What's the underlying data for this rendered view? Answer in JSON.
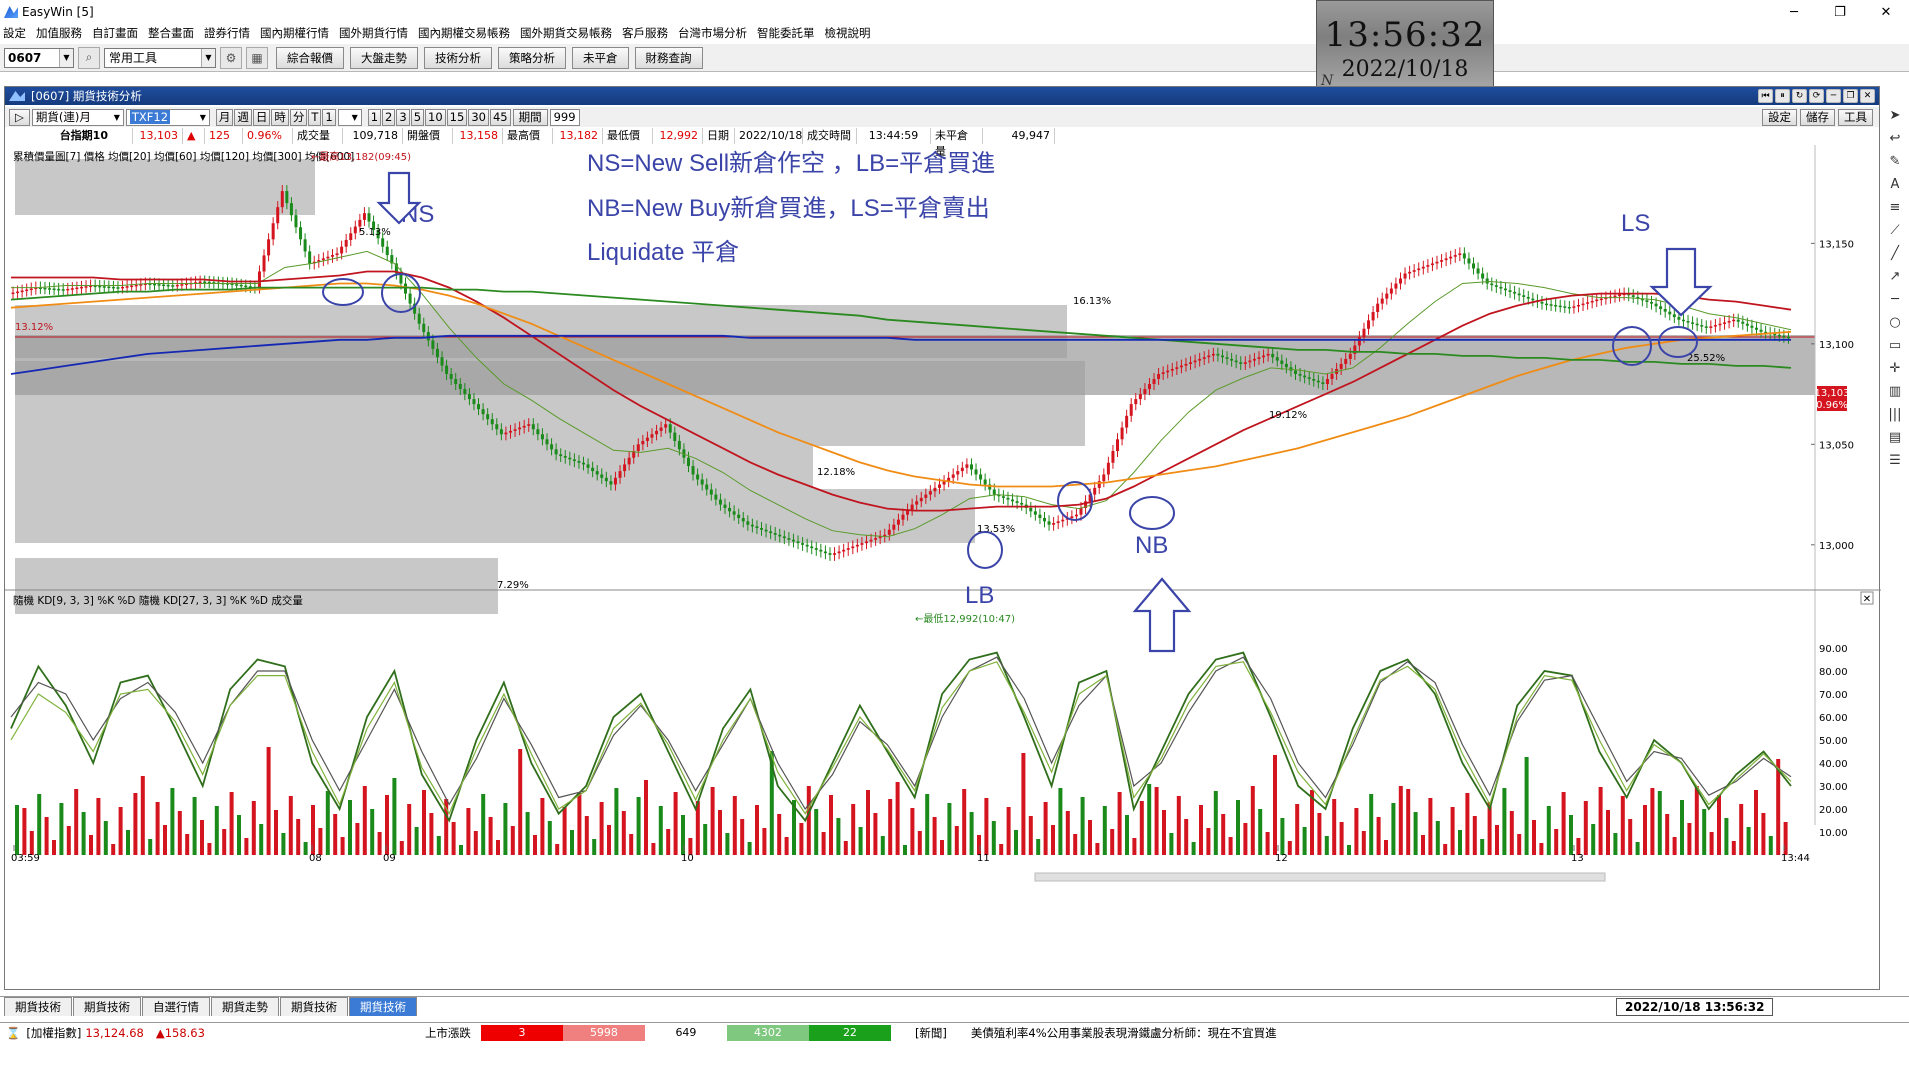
{
  "window": {
    "app_title": "EasyWin  [5]",
    "minimize": "─",
    "restore": "❐",
    "close": "✕"
  },
  "menu": [
    "設定",
    "加值服務",
    "自訂畫面",
    "整合畫面",
    "證券行情",
    "國內期權行情",
    "國外期貨行情",
    "國內期權交易帳務",
    "國外期貨交易帳務",
    "客戶服務",
    "台灣市場分析",
    "智能委託單",
    "檢視說明"
  ],
  "toolbar": {
    "code": "0607",
    "tool": "常用工具",
    "buttons": [
      "綜合報價",
      "大盤走勢",
      "技術分析",
      "策略分析",
      "未平倉",
      "財務查詢"
    ]
  },
  "clock": {
    "time": "13:56:32",
    "date": "2022/10/18",
    "mark": "N"
  },
  "panel": {
    "title": "[0607] 期貨技術分析",
    "controls": {
      "contract": "期貨(連)月",
      "symbol": "TXF12",
      "periods": [
        "月",
        "週",
        "日",
        "時",
        "分",
        "T",
        "1"
      ],
      "nums": [
        "1",
        "2",
        "3",
        "5",
        "10",
        "15",
        "30",
        "45"
      ],
      "period_label": "期間",
      "period_value": "999",
      "right_btns": [
        "設定",
        "儲存",
        "工具"
      ]
    },
    "info": {
      "name": "台指期10",
      "price": "13,103",
      "arrow": "▲",
      "change": "125",
      "pct": "0.96%",
      "vol_label": "成交量",
      "vol": "109,718",
      "open_label": "開盤價",
      "open": "13,158",
      "high_label": "最高價",
      "high": "13,182",
      "low_label": "最低價",
      "low": "12,992",
      "date_label": "日期",
      "date": "2022/10/18",
      "time_label": "成交時間",
      "time": "13:44:59",
      "oi_label": "未平倉量",
      "oi": "49,947"
    },
    "legend_top": "累積價量圖[7] 價格 均價[20] 均價[60] 均價[120] 均價[300] 均價[600]",
    "legend_bottom": "隨機 KD[9, 3, 3] %K %D 隨機 KD[27, 3, 3] %K %D 成交量"
  },
  "annotations": {
    "line1": "NS=New Sell新倉作空  ，LB=平倉買進",
    "line2": "NB=New Buy新倉買進，LS=平倉賣出",
    "line3": "Liquidate 平倉",
    "ns": "NS",
    "lb": "LB",
    "nb": "NB",
    "ls": "LS",
    "high_note": "←最高13,182(09:45)",
    "low_note": "←最低12,992(10:47)",
    "pct_513": "5.13%",
    "pct_1613": "16.13%",
    "pct_1218": "12.18%",
    "pct_729": "7.29%",
    "pct_1912": "19.12%",
    "pct_2552": "25.52%",
    "pct_1353": "13.53%",
    "pct_1312": "13.12%"
  },
  "chart_data": [
    {
      "type": "line",
      "title": "",
      "ylabel": "",
      "ylim": [
        12980,
        13185
      ],
      "y_ticks": [
        "13,150",
        "13,100",
        "13,050",
        "13,000"
      ],
      "x_ticks": [
        "03:59",
        "08",
        "09",
        "10",
        "11",
        "12",
        "13",
        "13:44"
      ],
      "last_price_label": "13,103",
      "last_pct_label": "0.96%",
      "grid": false,
      "series": [
        {
          "color": "#222222",
          "values": [
            13125,
            13128,
            13127,
            13129,
            13128,
            13130,
            13129,
            13131,
            13130,
            13128,
            13176,
            13140,
            13145,
            13165,
            13140,
            13110,
            13085,
            13070,
            13055,
            13060,
            13045,
            13040,
            13030,
            13050,
            13060,
            13035,
            13020,
            13010,
            13005,
            13000,
            12995,
            13000,
            13005,
            13020,
            13030,
            13040,
            13025,
            13020,
            13010,
            13015,
            13035,
            13070,
            13085,
            13090,
            13095,
            13090,
            13095,
            13085,
            13080,
            13095,
            13120,
            13135,
            13140,
            13145,
            13130,
            13125,
            13120,
            13118,
            13122,
            13125,
            13120,
            13112,
            13108,
            13112,
            13106,
            13103
          ]
        },
        {
          "color": "#5a9a2a",
          "values": [
            13128,
            13128,
            13129,
            13129,
            13129,
            13130,
            13130,
            13130,
            13130,
            13130,
            13138,
            13140,
            13143,
            13146,
            13140,
            13125,
            13108,
            13093,
            13080,
            13072,
            13063,
            13055,
            13047,
            13046,
            13048,
            13043,
            13036,
            13027,
            13020,
            13013,
            13007,
            13005,
            13004,
            13008,
            13015,
            13023,
            13025,
            13024,
            13020,
            13018,
            13022,
            13036,
            13052,
            13066,
            13077,
            13083,
            13088,
            13087,
            13085,
            13088,
            13098,
            13110,
            13121,
            13130,
            13131,
            13130,
            13128,
            13125,
            13123,
            13123,
            13122,
            13119,
            13115,
            13113,
            13110,
            13107
          ]
        },
        {
          "color": "#c0141e",
          "values": [
            13133,
            13133,
            13133,
            13133,
            13132,
            13132,
            13132,
            13132,
            13131,
            13131,
            13132,
            13133,
            13134,
            13136,
            13136,
            13133,
            13128,
            13121,
            13113,
            13104,
            13095,
            13086,
            13077,
            13069,
            13062,
            13055,
            13048,
            13041,
            13035,
            13030,
            13025,
            13021,
            13018,
            13017,
            13017,
            13018,
            13019,
            13019,
            13019,
            13020,
            13023,
            13029,
            13036,
            13043,
            13050,
            13057,
            13063,
            13069,
            13075,
            13081,
            13088,
            13095,
            13102,
            13109,
            13115,
            13119,
            13122,
            13124,
            13125,
            13125,
            13125,
            13124,
            13122,
            13121,
            13119,
            13117
          ]
        },
        {
          "color": "#f08c14",
          "values": [
            13118,
            13119,
            13120,
            13121,
            13122,
            13123,
            13124,
            13125,
            13126,
            13127,
            13128,
            13129,
            13130,
            13130,
            13129,
            13127,
            13124,
            13120,
            13115,
            13110,
            13104,
            13098,
            13092,
            13086,
            13080,
            13074,
            13068,
            13062,
            13056,
            13051,
            13046,
            13041,
            13037,
            13034,
            13032,
            13030,
            13029,
            13029,
            13029,
            13030,
            13031,
            13033,
            13035,
            13037,
            13039,
            13042,
            13045,
            13048,
            13052,
            13056,
            13060,
            13064,
            13069,
            13074,
            13079,
            13084,
            13088,
            13092,
            13095,
            13098,
            13100,
            13102,
            13103,
            13104,
            13105,
            13106
          ]
        },
        {
          "color": "#2a8a20",
          "values": [
            13122,
            13123,
            13124,
            13125,
            13126,
            13126,
            13127,
            13127,
            13127,
            13128,
            13128,
            13128,
            13128,
            13128,
            13128,
            13128,
            13127,
            13127,
            13126,
            13126,
            13125,
            13124,
            13123,
            13122,
            13121,
            13120,
            13119,
            13118,
            13117,
            13116,
            13115,
            13114,
            13112,
            13111,
            13110,
            13109,
            13108,
            13107,
            13106,
            13105,
            13104,
            13103,
            13102,
            13101,
            13100,
            13099,
            13098,
            13097,
            13097,
            13096,
            13096,
            13095,
            13095,
            13094,
            13094,
            13093,
            13093,
            13092,
            13092,
            13091,
            13091,
            13090,
            13090,
            13089,
            13089,
            13088
          ]
        },
        {
          "color": "#1428b4",
          "values": [
            13085,
            13087,
            13089,
            13091,
            13093,
            13095,
            13096,
            13097,
            13098,
            13099,
            13100,
            13101,
            13102,
            13102,
            13103,
            13103,
            13104,
            13104,
            13104,
            13104,
            13104,
            13104,
            13104,
            13104,
            13104,
            13104,
            13104,
            13103,
            13103,
            13103,
            13103,
            13103,
            13103,
            13102,
            13102,
            13102,
            13102,
            13102,
            13102,
            13102,
            13102,
            13102,
            13102,
            13102,
            13102,
            13102,
            13102,
            13102,
            13102,
            13102,
            13102,
            13102,
            13102,
            13102,
            13102,
            13102,
            13102,
            13102,
            13102,
            13102,
            13102,
            13102,
            13102,
            13102,
            13102,
            13102
          ]
        }
      ]
    },
    {
      "type": "line",
      "title": "",
      "ylabel": "",
      "ylim": [
        0,
        100
      ],
      "y_ticks": [
        "90.00",
        "80.00",
        "70.00",
        "60.00",
        "50.00",
        "40.00",
        "30.00",
        "20.00",
        "10.00"
      ],
      "series": [
        {
          "color": "#2f6e1a",
          "values": [
            55,
            82,
            65,
            40,
            75,
            78,
            55,
            30,
            72,
            85,
            82,
            40,
            20,
            60,
            80,
            35,
            15,
            50,
            75,
            40,
            18,
            30,
            60,
            70,
            45,
            20,
            55,
            72,
            30,
            15,
            40,
            65,
            45,
            25,
            70,
            85,
            88,
            60,
            30,
            75,
            80,
            20,
            45,
            70,
            85,
            88,
            60,
            30,
            20,
            55,
            80,
            85,
            70,
            40,
            20,
            65,
            80,
            78,
            45,
            25,
            50,
            40,
            20,
            35,
            45,
            30
          ]
        },
        {
          "color": "#555555",
          "values": [
            60,
            75,
            70,
            50,
            68,
            75,
            62,
            40,
            65,
            80,
            80,
            50,
            28,
            50,
            72,
            45,
            22,
            42,
            68,
            48,
            25,
            28,
            52,
            65,
            50,
            28,
            48,
            68,
            40,
            20,
            35,
            58,
            48,
            30,
            60,
            80,
            86,
            68,
            40,
            65,
            78,
            30,
            40,
            62,
            80,
            86,
            68,
            40,
            25,
            48,
            75,
            84,
            75,
            48,
            26,
            58,
            76,
            78,
            55,
            32,
            45,
            42,
            26,
            32,
            42,
            34
          ]
        },
        {
          "color": "#7fb23a",
          "values": [
            50,
            70,
            62,
            45,
            70,
            72,
            58,
            35,
            65,
            78,
            78,
            45,
            22,
            55,
            75,
            38,
            18,
            46,
            70,
            44,
            20,
            28,
            55,
            66,
            48,
            24,
            50,
            68,
            36,
            18,
            38,
            60,
            46,
            28,
            64,
            80,
            84,
            62,
            36,
            70,
            78,
            25,
            42,
            66,
            82,
            84,
            62,
            36,
            22,
            50,
            76,
            82,
            72,
            44,
            22,
            60,
            78,
            76,
            50,
            28,
            48,
            40,
            22,
            33,
            44,
            32
          ]
        }
      ]
    }
  ]
}
